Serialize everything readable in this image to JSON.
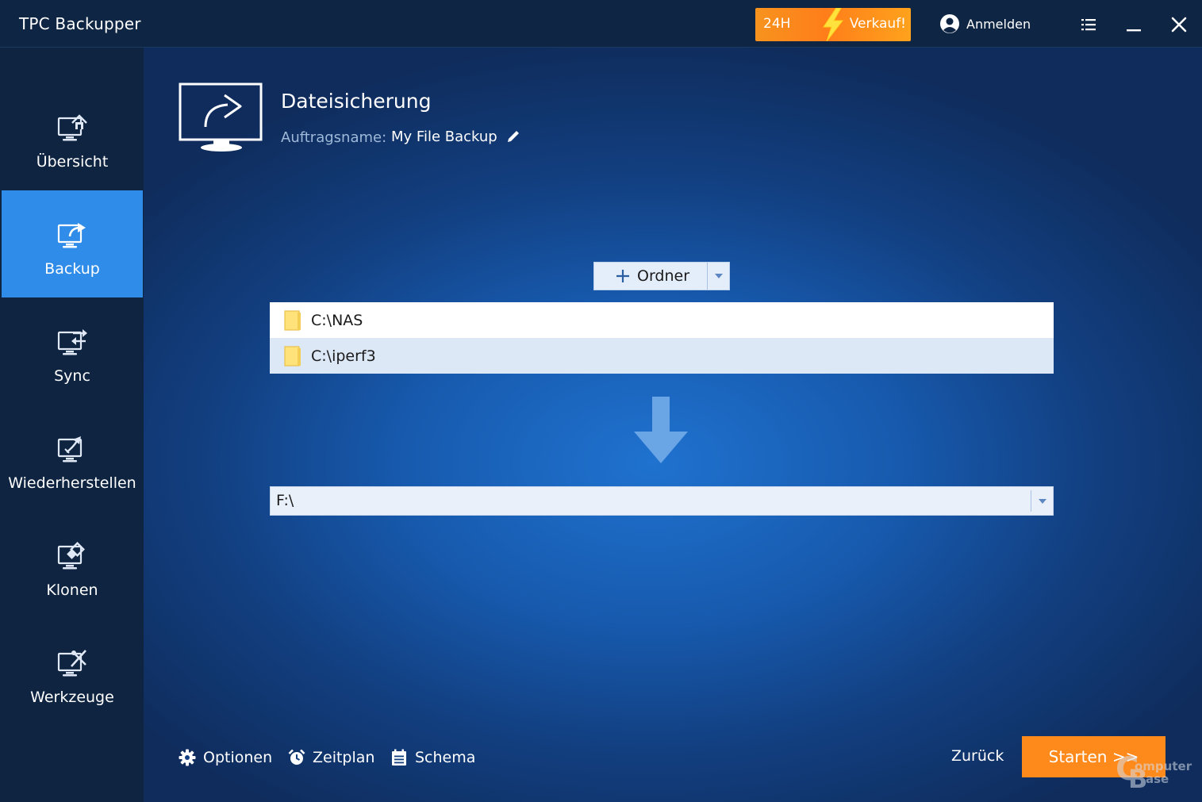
{
  "app": {
    "title": "TPC Backupper"
  },
  "titlebar": {
    "sale_badge_left": "24H",
    "sale_badge_right": "Verkauf!",
    "login_label": "Anmelden"
  },
  "sidebar": {
    "items": [
      {
        "label": "Übersicht",
        "icon": "home-monitor-icon",
        "active": false
      },
      {
        "label": "Backup",
        "icon": "backup-monitor-icon",
        "active": true
      },
      {
        "label": "Sync",
        "icon": "sync-monitor-icon",
        "active": false
      },
      {
        "label": "Wiederherstellen",
        "icon": "restore-monitor-icon",
        "active": false
      },
      {
        "label": "Klonen",
        "icon": "clone-monitor-icon",
        "active": false
      },
      {
        "label": "Werkzeuge",
        "icon": "tools-monitor-icon",
        "active": false
      }
    ]
  },
  "main": {
    "page_title": "Dateisicherung",
    "job_name_label": "Auftragsname:",
    "job_name_value": "My File Backup",
    "add_folder_label": "Ordner",
    "sources": [
      {
        "path": "C:\\NAS",
        "selected": false
      },
      {
        "path": "C:\\iperf3",
        "selected": true
      }
    ],
    "destination": "F:\\",
    "footer": {
      "options_label": "Optionen",
      "schedule_label": "Zeitplan",
      "scheme_label": "Schema",
      "back_label": "Zurück",
      "start_label": "Starten >>"
    }
  },
  "watermark": {
    "line1": "omputer",
    "line2": "ase"
  },
  "colors": {
    "accent": "#2f8ce8",
    "start_button": "#ff8a1c",
    "sale_banner": "#f7931e",
    "sidebar_bg": "#0f2441"
  }
}
